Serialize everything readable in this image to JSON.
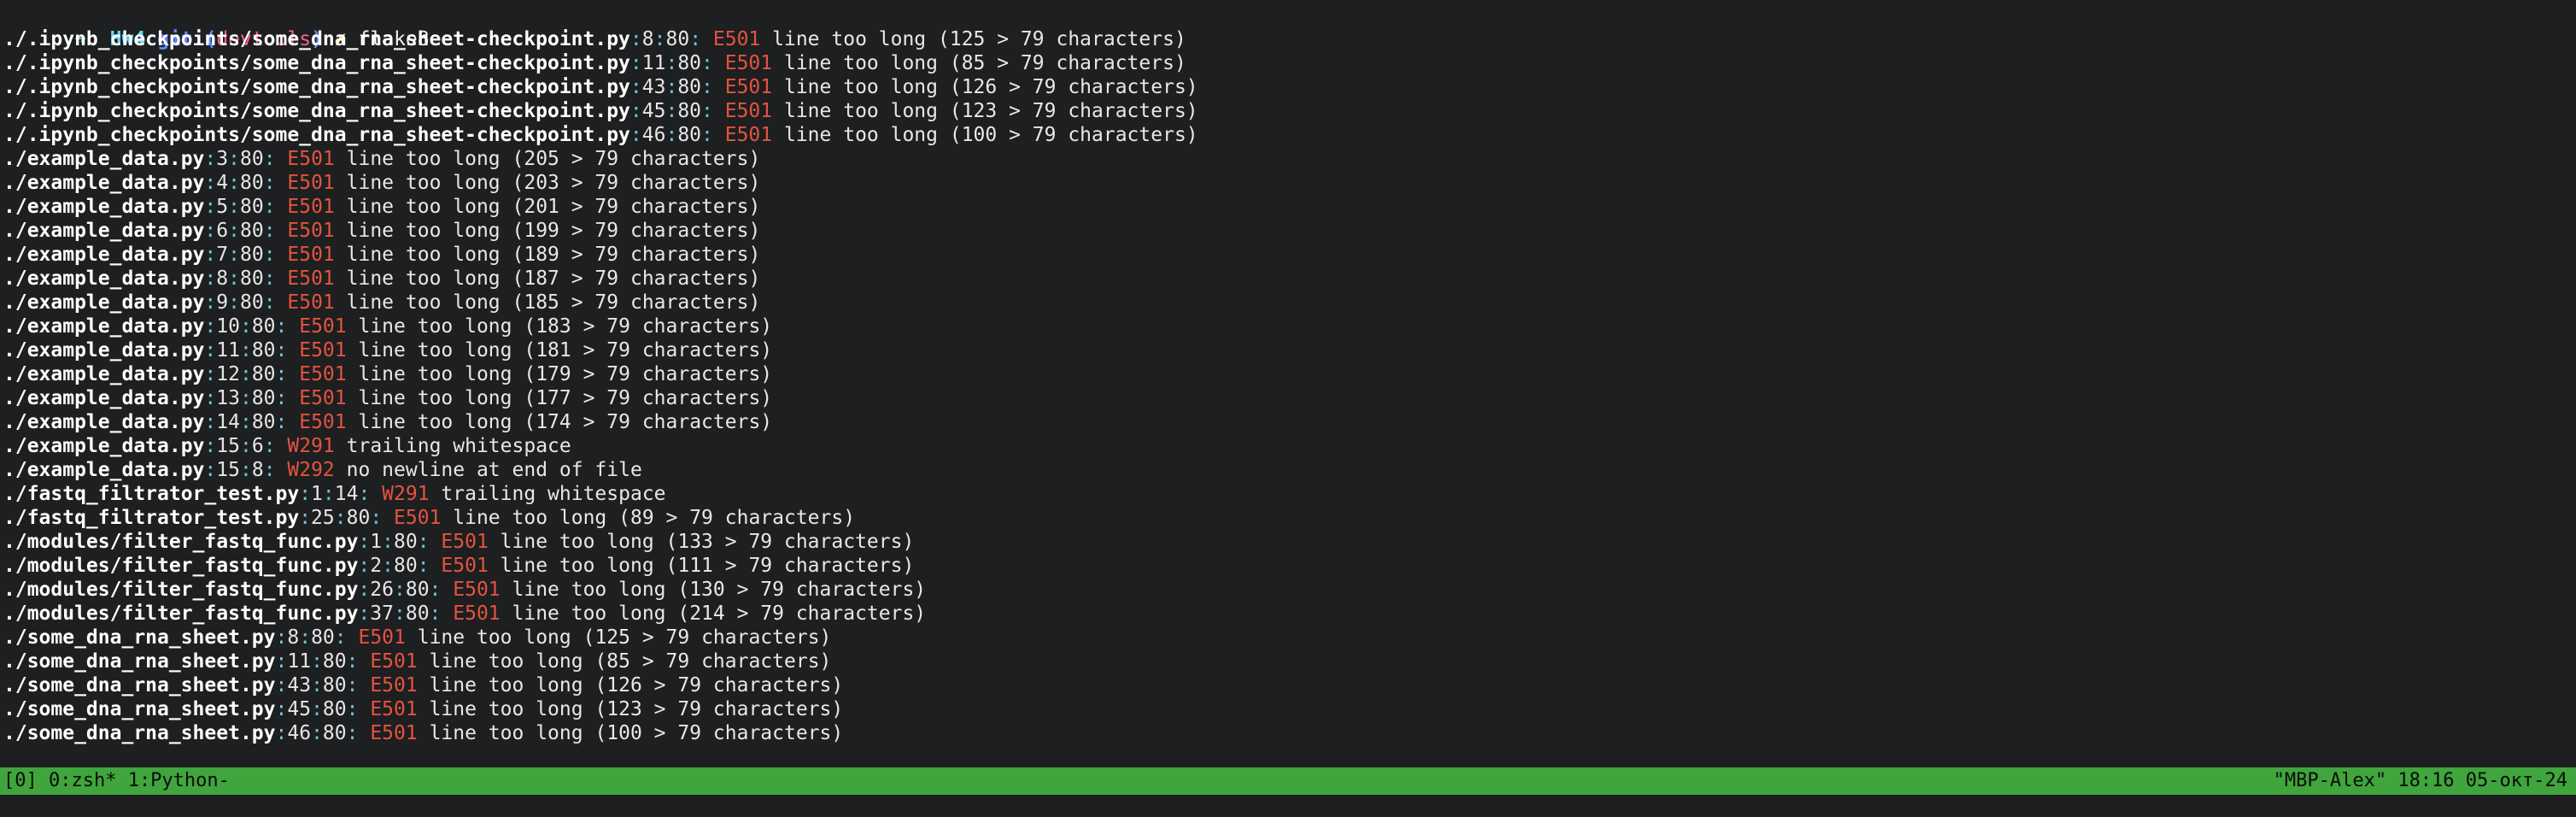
{
  "prompt": {
    "arrow": "➜",
    "dir": "Hw4",
    "git_prefix": "git:(",
    "branch": "devtools",
    "git_suffix": ")",
    "dirty_mark": "✗",
    "command": "flake8"
  },
  "output": [
    {
      "file": "./.ipynb_checkpoints/some_dna_rna_sheet-checkpoint.py",
      "line": "8",
      "col": "80",
      "code": "E501",
      "message": "line too long (125 > 79 characters)"
    },
    {
      "file": "./.ipynb_checkpoints/some_dna_rna_sheet-checkpoint.py",
      "line": "11",
      "col": "80",
      "code": "E501",
      "message": "line too long (85 > 79 characters)"
    },
    {
      "file": "./.ipynb_checkpoints/some_dna_rna_sheet-checkpoint.py",
      "line": "43",
      "col": "80",
      "code": "E501",
      "message": "line too long (126 > 79 characters)"
    },
    {
      "file": "./.ipynb_checkpoints/some_dna_rna_sheet-checkpoint.py",
      "line": "45",
      "col": "80",
      "code": "E501",
      "message": "line too long (123 > 79 characters)"
    },
    {
      "file": "./.ipynb_checkpoints/some_dna_rna_sheet-checkpoint.py",
      "line": "46",
      "col": "80",
      "code": "E501",
      "message": "line too long (100 > 79 characters)"
    },
    {
      "file": "./example_data.py",
      "line": "3",
      "col": "80",
      "code": "E501",
      "message": "line too long (205 > 79 characters)"
    },
    {
      "file": "./example_data.py",
      "line": "4",
      "col": "80",
      "code": "E501",
      "message": "line too long (203 > 79 characters)"
    },
    {
      "file": "./example_data.py",
      "line": "5",
      "col": "80",
      "code": "E501",
      "message": "line too long (201 > 79 characters)"
    },
    {
      "file": "./example_data.py",
      "line": "6",
      "col": "80",
      "code": "E501",
      "message": "line too long (199 > 79 characters)"
    },
    {
      "file": "./example_data.py",
      "line": "7",
      "col": "80",
      "code": "E501",
      "message": "line too long (189 > 79 characters)"
    },
    {
      "file": "./example_data.py",
      "line": "8",
      "col": "80",
      "code": "E501",
      "message": "line too long (187 > 79 characters)"
    },
    {
      "file": "./example_data.py",
      "line": "9",
      "col": "80",
      "code": "E501",
      "message": "line too long (185 > 79 characters)"
    },
    {
      "file": "./example_data.py",
      "line": "10",
      "col": "80",
      "code": "E501",
      "message": "line too long (183 > 79 characters)"
    },
    {
      "file": "./example_data.py",
      "line": "11",
      "col": "80",
      "code": "E501",
      "message": "line too long (181 > 79 characters)"
    },
    {
      "file": "./example_data.py",
      "line": "12",
      "col": "80",
      "code": "E501",
      "message": "line too long (179 > 79 characters)"
    },
    {
      "file": "./example_data.py",
      "line": "13",
      "col": "80",
      "code": "E501",
      "message": "line too long (177 > 79 characters)"
    },
    {
      "file": "./example_data.py",
      "line": "14",
      "col": "80",
      "code": "E501",
      "message": "line too long (174 > 79 characters)"
    },
    {
      "file": "./example_data.py",
      "line": "15",
      "col": "6",
      "code": "W291",
      "message": "trailing whitespace"
    },
    {
      "file": "./example_data.py",
      "line": "15",
      "col": "8",
      "code": "W292",
      "message": "no newline at end of file"
    },
    {
      "file": "./fastq_filtrator_test.py",
      "line": "1",
      "col": "14",
      "code": "W291",
      "message": "trailing whitespace"
    },
    {
      "file": "./fastq_filtrator_test.py",
      "line": "25",
      "col": "80",
      "code": "E501",
      "message": "line too long (89 > 79 characters)"
    },
    {
      "file": "./modules/filter_fastq_func.py",
      "line": "1",
      "col": "80",
      "code": "E501",
      "message": "line too long (133 > 79 characters)"
    },
    {
      "file": "./modules/filter_fastq_func.py",
      "line": "2",
      "col": "80",
      "code": "E501",
      "message": "line too long (111 > 79 characters)"
    },
    {
      "file": "./modules/filter_fastq_func.py",
      "line": "26",
      "col": "80",
      "code": "E501",
      "message": "line too long (130 > 79 characters)"
    },
    {
      "file": "./modules/filter_fastq_func.py",
      "line": "37",
      "col": "80",
      "code": "E501",
      "message": "line too long (214 > 79 characters)"
    },
    {
      "file": "./some_dna_rna_sheet.py",
      "line": "8",
      "col": "80",
      "code": "E501",
      "message": "line too long (125 > 79 characters)"
    },
    {
      "file": "./some_dna_rna_sheet.py",
      "line": "11",
      "col": "80",
      "code": "E501",
      "message": "line too long (85 > 79 characters)"
    },
    {
      "file": "./some_dna_rna_sheet.py",
      "line": "43",
      "col": "80",
      "code": "E501",
      "message": "line too long (126 > 79 characters)"
    },
    {
      "file": "./some_dna_rna_sheet.py",
      "line": "45",
      "col": "80",
      "code": "E501",
      "message": "line too long (123 > 79 characters)"
    },
    {
      "file": "./some_dna_rna_sheet.py",
      "line": "46",
      "col": "80",
      "code": "E501",
      "message": "line too long (100 > 79 characters)"
    }
  ],
  "statusbar": {
    "left": "[0] 0:zsh* 1:Python-",
    "right": "\"MBP-Alex\" 18:16 05-окт-24"
  },
  "colors": {
    "background": "#1d1f21",
    "statusbar": "#3fa53c",
    "error_code": "#e5533e",
    "separator": "#6fc2d8"
  }
}
